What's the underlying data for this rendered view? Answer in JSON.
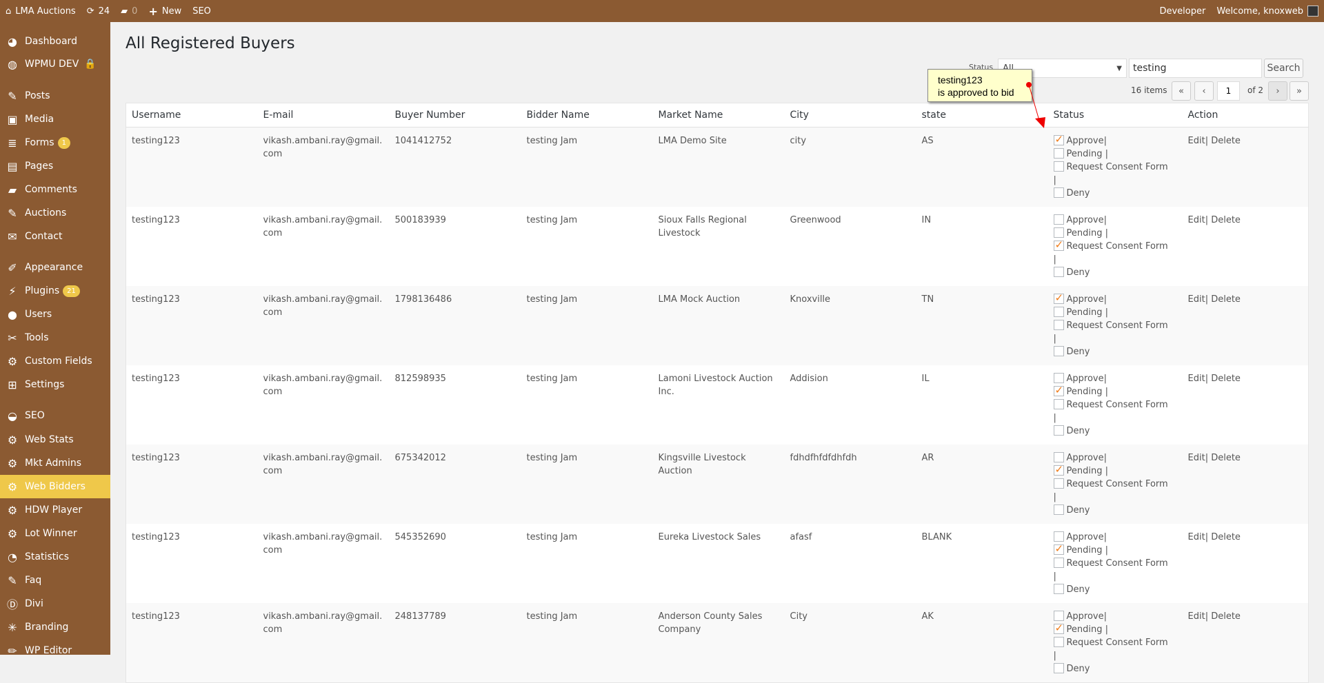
{
  "topbar": {
    "site": "LMA Auctions",
    "updates": "24",
    "comments": "0",
    "new": "New",
    "seo": "SEO",
    "developer": "Developer",
    "welcome": "Welcome, knoxweb"
  },
  "sidebar": [
    {
      "label": "Dashboard",
      "icon": "dashboard-icon"
    },
    {
      "label": "WPMU DEV",
      "icon": "wpmu-icon"
    },
    {
      "label": "Posts",
      "icon": "pin-icon"
    },
    {
      "label": "Media",
      "icon": "media-icon"
    },
    {
      "label": "Forms",
      "icon": "forms-icon",
      "badge": "1"
    },
    {
      "label": "Pages",
      "icon": "pages-icon"
    },
    {
      "label": "Comments",
      "icon": "comment-icon"
    },
    {
      "label": "Auctions",
      "icon": "pin-icon"
    },
    {
      "label": "Contact",
      "icon": "mail-icon"
    },
    {
      "label": "Appearance",
      "icon": "brush-icon"
    },
    {
      "label": "Plugins",
      "icon": "plugin-icon",
      "badge": "21"
    },
    {
      "label": "Users",
      "icon": "user-icon"
    },
    {
      "label": "Tools",
      "icon": "wrench-icon"
    },
    {
      "label": "Custom Fields",
      "icon": "gear-icon"
    },
    {
      "label": "Settings",
      "icon": "settings-icon"
    },
    {
      "label": "SEO",
      "icon": "seo-icon"
    },
    {
      "label": "Web Stats",
      "icon": "gear-icon"
    },
    {
      "label": "Mkt Admins",
      "icon": "gear-icon"
    },
    {
      "label": "Web Bidders",
      "icon": "gear-icon",
      "active": true
    },
    {
      "label": "HDW Player",
      "icon": "gear-icon"
    },
    {
      "label": "Lot Winner",
      "icon": "gear-icon"
    },
    {
      "label": "Statistics",
      "icon": "pie-icon"
    },
    {
      "label": "Faq",
      "icon": "pin-icon"
    },
    {
      "label": "Divi",
      "icon": "divi-icon"
    },
    {
      "label": "Branding",
      "icon": "wand-icon"
    },
    {
      "label": "WP Editor",
      "icon": "pencil-icon"
    }
  ],
  "page": {
    "title": "All Registered Buyers",
    "status_label": "Status",
    "status_value": "All",
    "search_value": "testing",
    "search_button": "Search",
    "items": "16 items",
    "page": "1",
    "of": "of 2",
    "first": "«",
    "prev": "‹",
    "next": "›",
    "last": "»"
  },
  "note": {
    "line1": "testing123",
    "line2": "is approved to bid"
  },
  "table": {
    "headers": [
      "Username",
      "E-mail",
      "Buyer Number",
      "Bidder Name",
      "Market Name",
      "City",
      "state",
      "Status",
      "Action"
    ],
    "status_labels": [
      "Approve|",
      "Pending |",
      "Request Consent Form",
      "|",
      "Deny"
    ],
    "edit": "Edit|",
    "delete": "Delete",
    "rows": [
      {
        "username": "testing123",
        "email": "vikash.ambani.ray@gmail.com",
        "buyer": "1041412752",
        "bidder": "testing Jam",
        "market": "LMA Demo Site",
        "city": "city",
        "state": "AS",
        "status": 0
      },
      {
        "username": "testing123",
        "email": "vikash.ambani.ray@gmail.com",
        "buyer": "500183939",
        "bidder": "testing Jam",
        "market": "Sioux Falls Regional Livestock",
        "city": "Greenwood",
        "state": "IN",
        "status": 2
      },
      {
        "username": "testing123",
        "email": "vikash.ambani.ray@gmail.com",
        "buyer": "1798136486",
        "bidder": "testing Jam",
        "market": "LMA Mock Auction",
        "city": "Knoxville",
        "state": "TN",
        "status": 0
      },
      {
        "username": "testing123",
        "email": "vikash.ambani.ray@gmail.com",
        "buyer": "812598935",
        "bidder": "testing Jam",
        "market": "Lamoni Livestock Auction Inc.",
        "city": "Addision",
        "state": "IL",
        "status": 1
      },
      {
        "username": "testing123",
        "email": "vikash.ambani.ray@gmail.com",
        "buyer": "675342012",
        "bidder": "testing Jam",
        "market": "Kingsville Livestock Auction",
        "city": "fdhdfhfdfdhfdh",
        "state": "AR",
        "status": 1
      },
      {
        "username": "testing123",
        "email": "vikash.ambani.ray@gmail.com",
        "buyer": "545352690",
        "bidder": "testing Jam",
        "market": "Eureka Livestock Sales",
        "city": "afasf",
        "state": "BLANK",
        "status": 1
      },
      {
        "username": "testing123",
        "email": "vikash.ambani.ray@gmail.com",
        "buyer": "248137789",
        "bidder": "testing Jam",
        "market": "Anderson County Sales Company",
        "city": "City",
        "state": "AK",
        "status": 1
      }
    ]
  }
}
